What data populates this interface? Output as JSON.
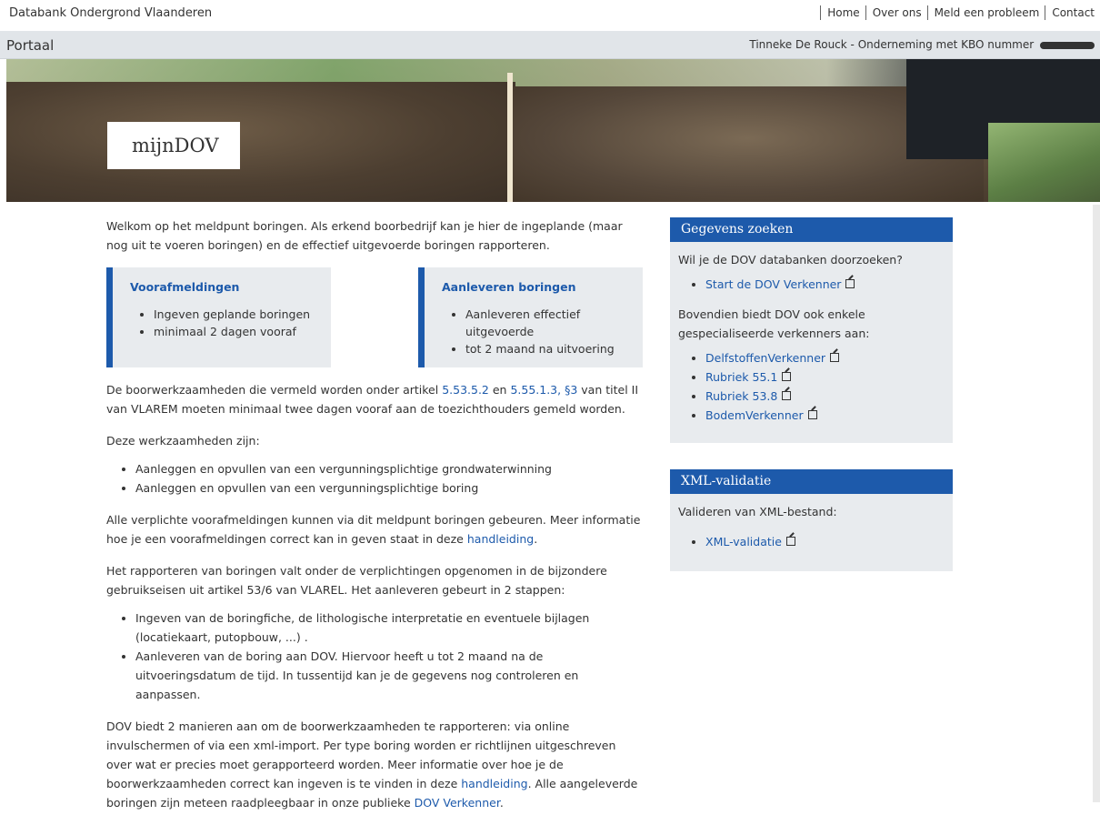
{
  "header": {
    "site_title": "Databank Ondergrond Vlaanderen",
    "nav": [
      "Home",
      "Over ons",
      "Meld een probleem",
      "Contact"
    ]
  },
  "portal": {
    "label": "Portaal",
    "user": "Tinneke De Rouck - Onderneming met KBO nummer"
  },
  "hero": {
    "title": "mijnDOV"
  },
  "main": {
    "intro": "Welkom op het meldpunt boringen. Als erkend boorbedrijf kan je hier de ingeplande (maar nog uit te voeren boringen) en de effectief uitgevoerde boringen rapporteren.",
    "card1": {
      "title": "Voorafmeldingen",
      "items": [
        "Ingeven geplande boringen",
        "minimaal 2 dagen vooraf"
      ]
    },
    "card2": {
      "title": "Aanleveren boringen",
      "items": [
        "Aanleveren effectief uitgevoerde",
        "tot 2 maand na uitvoering"
      ]
    },
    "p2": {
      "pre": "De boorwerkzaamheden die vermeld worden onder artikel ",
      "link1": "5.53.5.2",
      "mid1": " en ",
      "link2": "5.55.1.3, §3",
      "post": " van titel II van VLAREM moeten minimaal twee dagen vooraf aan de toezichthouders gemeld worden."
    },
    "p3": "Deze werkzaamheden zijn:",
    "list1": [
      "Aanleggen en opvullen van een vergunningsplichtige grondwaterwinning",
      "Aanleggen  en opvullen van een vergunningsplichtige boring"
    ],
    "p4": {
      "pre": "Alle verplichte voorafmeldingen kunnen via dit meldpunt boringen gebeuren. Meer informatie hoe je een voorafmeldingen correct kan in geven staat in deze ",
      "link": "handleiding",
      "post": "."
    },
    "p5": "Het rapporteren van boringen valt onder de verplichtingen opgenomen in de bijzondere gebruikseisen uit artikel 53/6 van VLAREL. Het aanleveren gebeurt in 2 stappen:",
    "list2": [
      "Ingeven van de boringfiche, de lithologische interpretatie en eventuele bijlagen (locatiekaart, putopbouw, ...) .",
      "Aanleveren van de boring aan DOV. Hiervoor heeft u tot 2 maand na de uitvoeringsdatum de tijd. In tussentijd kan je de gegevens nog controleren en aanpassen."
    ],
    "p6": {
      "pre": "DOV biedt 2 manieren aan om de boorwerkzaamheden te rapporteren: via online invulschermen of via een xml-import. Per type boring worden er richtlijnen uitgeschreven over wat er precies moet gerapporteerd worden. Meer informatie over hoe je de boorwerkzaamheden correct kan ingeven is te vinden in deze ",
      "link1": "handleiding",
      "mid": ". Alle aangeleverde boringen zijn meteen raadpleegbaar in onze publieke ",
      "link2": "DOV Verkenner",
      "post": "."
    }
  },
  "sidebar": {
    "search": {
      "title": "Gegevens zoeken",
      "q": "Wil je de DOV databanken doorzoeken?",
      "link_main": "Start de DOV Verkenner",
      "more": "Bovendien biedt DOV ook enkele gespecialiseerde verkenners aan:",
      "links": [
        "DelfstoffenVerkenner",
        "Rubriek 55.1",
        "Rubriek 53.8",
        "BodemVerkenner"
      ]
    },
    "xml": {
      "title": "XML-validatie",
      "text": "Valideren van XML-bestand:",
      "link": "XML-validatie"
    }
  },
  "colors": {
    "accent": "#1d5aab",
    "panel_bg": "#e8ebee",
    "bar_bg": "#e1e5e9"
  },
  "icons": [
    "external-link-icon"
  ]
}
